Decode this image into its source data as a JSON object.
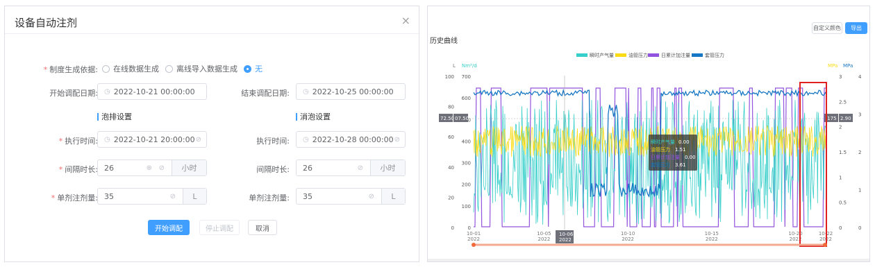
{
  "dialog": {
    "title": "设备自动注剂",
    "close": "×",
    "basis_label": "制度生成依据:",
    "radio_options": [
      {
        "label": "在线数据生成",
        "checked": false
      },
      {
        "label": "离线导入数据生成",
        "checked": false
      },
      {
        "label": "无",
        "checked": true
      }
    ],
    "start_date_label": "开始调配日期:",
    "start_date_value": "2022-10-21 00:00:00",
    "end_date_label": "结束调配日期:",
    "end_date_value": "2022-10-25 00:00:00",
    "foam_section": "泡排设置",
    "defoam_section": "消泡设置",
    "foam_exec_label": "执行时间:",
    "foam_exec_value": "2022-10-21 20:00:00",
    "defoam_exec_label": "执行时间:",
    "defoam_exec_value": "2022-10-28 00:00:00",
    "foam_interval_label": "间隔时长:",
    "foam_interval_value": "26",
    "foam_interval_unit": "小时",
    "defoam_interval_label": "间隔时长:",
    "defoam_interval_value": "26",
    "defoam_interval_unit": "小时",
    "foam_dose_label": "单剂注剂量:",
    "foam_dose_value": "35",
    "foam_dose_unit": "L",
    "defoam_dose_label": "单剂注剂量:",
    "defoam_dose_value": "35",
    "defoam_dose_unit": "L",
    "btn_start": "开始调配",
    "btn_stop": "停止调配",
    "btn_cancel": "取消",
    "primary_color": "#409eff",
    "required_color": "#f56c6c"
  },
  "panel": {
    "title": "历史曲线",
    "btn_custom_color": "自定义颜色",
    "btn_export": "导出"
  },
  "chart_data": {
    "type": "line",
    "title": "历史曲线",
    "legend": [
      {
        "name": "瞬时产气量",
        "color": "#36cfc9"
      },
      {
        "name": "油管压力",
        "color": "#fadb14"
      },
      {
        "name": "日累计加注量",
        "color": "#9254de"
      },
      {
        "name": "套管压力",
        "color": "#1677c4"
      }
    ],
    "legend_position": "top-center",
    "axes": {
      "left_outer": {
        "unit": "L",
        "ticks": [
          "0",
          "20",
          "40",
          "60",
          "80",
          "100"
        ],
        "range": [
          0,
          100
        ]
      },
      "left_inner": {
        "unit": "Nm³/d",
        "ticks": [
          "0",
          "100",
          "200",
          "300",
          "400",
          "500",
          "600",
          "700"
        ],
        "range": [
          0,
          700
        ]
      },
      "right_inner": {
        "unit": "MPa",
        "ticks": [
          "0",
          "0.5",
          "1",
          "1.5",
          "2",
          "2.5",
          "3"
        ],
        "range": [
          0,
          3
        ]
      },
      "right_outer": {
        "unit": "MPa",
        "ticks": [
          "0",
          "1",
          "2",
          "3",
          "4"
        ],
        "range": [
          0,
          4
        ]
      }
    },
    "x_ticks": [
      {
        "date": "10-01",
        "year": "2022"
      },
      {
        "date": "10-05",
        "year": "2022"
      },
      {
        "date": "10-10",
        "year": "2022"
      },
      {
        "date": "10-15",
        "year": "2022"
      },
      {
        "date": "10-20",
        "year": "2022"
      },
      {
        "date": "10-22",
        "year": "2022"
      }
    ],
    "x_range": [
      "2022-10-01",
      "2022-10-22"
    ],
    "crosshair": {
      "x_label_date": "10-06",
      "x_label_year": "2022",
      "left_labels": [
        "72.50",
        "07.50"
      ],
      "right_labels": [
        ".175",
        "2.90"
      ]
    },
    "tooltip": [
      {
        "name": "瞬时产气量",
        "value": "0.00"
      },
      {
        "name": "油管压力",
        "value": "1.51"
      },
      {
        "name": "日累计加注量",
        "value": "0.00"
      },
      {
        "name": "套管压力",
        "value": "3.61"
      }
    ],
    "highlight_region": "10-20 to 10-22",
    "grid": false
  }
}
